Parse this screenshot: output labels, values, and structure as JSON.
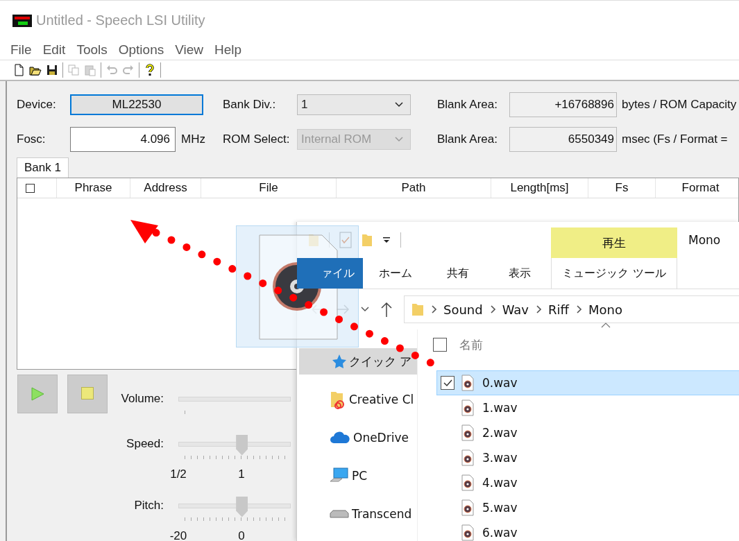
{
  "window": {
    "title": "Untitled - Speech LSI Utility"
  },
  "menu": [
    "File",
    "Edit",
    "Tools",
    "Options",
    "View",
    "Help"
  ],
  "toolbar": [
    [
      {
        "kind": "new",
        "disabled": false
      },
      {
        "kind": "open",
        "disabled": false
      },
      {
        "kind": "save",
        "disabled": false
      }
    ],
    [
      {
        "kind": "copy",
        "disabled": true
      },
      {
        "kind": "paste",
        "disabled": true
      }
    ],
    [
      {
        "kind": "undo",
        "disabled": true
      },
      {
        "kind": "redo",
        "disabled": true
      }
    ],
    [
      {
        "kind": "help",
        "disabled": false
      }
    ]
  ],
  "device": {
    "label": "Device:",
    "value": "ML22530"
  },
  "bank_div": {
    "label": "Bank Div.:",
    "value": "1",
    "disabled": false
  },
  "blank_area_bytes": {
    "label": "Blank Area:",
    "value": "+16768896",
    "unit": "bytes / ROM Capacity"
  },
  "fosc": {
    "label": "Fosc:",
    "value": "4.096",
    "unit": "MHz"
  },
  "rom_select": {
    "label": "ROM Select:",
    "value": "Internal ROM",
    "disabled": true
  },
  "blank_area_msec": {
    "label": "Blank Area:",
    "value": "6550349",
    "unit": "msec (Fs / Format ="
  },
  "bank_tabs": [
    {
      "label": "Bank 1",
      "selected": true
    }
  ],
  "table": {
    "select_all_checked": false,
    "columns": [
      "Phrase",
      "Address",
      "File",
      "Path",
      "Length[ms]",
      "Fs",
      "Format"
    ]
  },
  "sliders": [
    {
      "label": "Volume:"
    },
    {
      "label": "Speed:",
      "level": 0.57,
      "scale": [
        "1/2",
        "1"
      ]
    },
    {
      "label": "Pitch:",
      "level": 0.57,
      "scale": [
        "-20",
        "0"
      ]
    }
  ],
  "explorer": {
    "title": "Mono",
    "contextual_header": "再生",
    "ribbon_tabs": [
      {
        "label": "ァイル",
        "kind": "file"
      },
      {
        "label": "ホーム",
        "kind": "tab"
      },
      {
        "label": "共有",
        "kind": "tab"
      },
      {
        "label": "表示",
        "kind": "tab"
      },
      {
        "label": "ミュージック ツール",
        "kind": "contextual"
      }
    ],
    "breadcrumbs": [
      "Sound",
      "Wav",
      "Riff",
      "Mono"
    ],
    "nav": [
      {
        "label": "クイック ア",
        "kind": "quick",
        "selected": true
      },
      {
        "label": "Creative Cl",
        "kind": "cloud-folder",
        "selected": false
      },
      {
        "label": "OneDrive",
        "kind": "onedrive",
        "selected": false
      },
      {
        "label": "PC",
        "kind": "pc",
        "selected": false
      },
      {
        "label": "Transcend",
        "kind": "drive",
        "selected": false
      }
    ],
    "list_header": "名前",
    "select_all_checked": false,
    "files": [
      {
        "name": "0.wav",
        "selected": true,
        "checked": true
      },
      {
        "name": "1.wav",
        "selected": false,
        "checked": false
      },
      {
        "name": "2.wav",
        "selected": false,
        "checked": false
      },
      {
        "name": "3.wav",
        "selected": false,
        "checked": false
      },
      {
        "name": "4.wav",
        "selected": false,
        "checked": false
      },
      {
        "name": "5.wav",
        "selected": false,
        "checked": false
      },
      {
        "name": "6.wav",
        "selected": false,
        "checked": false
      }
    ]
  }
}
